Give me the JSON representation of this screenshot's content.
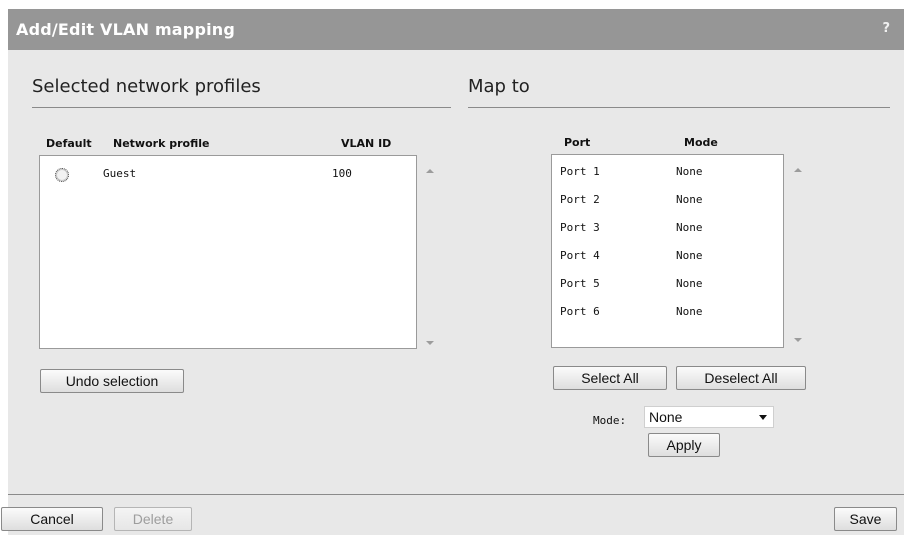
{
  "dialog": {
    "title": "Add/Edit VLAN mapping",
    "help": "?"
  },
  "left": {
    "section_title": "Selected network profiles",
    "columns": [
      "Default",
      "Network profile",
      "VLAN ID"
    ],
    "rows": [
      {
        "profile": "Guest",
        "vlan": "100"
      }
    ],
    "undo_label": "Undo selection"
  },
  "right": {
    "section_title": "Map to",
    "columns": [
      "Port",
      "Mode"
    ],
    "ports": [
      {
        "port": "Port 1",
        "mode": "None"
      },
      {
        "port": "Port 2",
        "mode": "None"
      },
      {
        "port": "Port 3",
        "mode": "None"
      },
      {
        "port": "Port 4",
        "mode": "None"
      },
      {
        "port": "Port 5",
        "mode": "None"
      },
      {
        "port": "Port 6",
        "mode": "None"
      }
    ],
    "select_all_label": "Select All",
    "deselect_all_label": "Deselect All",
    "mode_label": "Mode:",
    "mode_value": "None",
    "apply_label": "Apply"
  },
  "footer": {
    "cancel_label": "Cancel",
    "delete_label": "Delete",
    "save_label": "Save"
  }
}
